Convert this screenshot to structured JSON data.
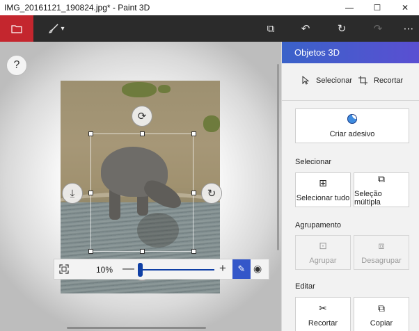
{
  "window": {
    "title": "IMG_20161121_190824.jpg* - Paint 3D",
    "minimize": "—",
    "maximize": "☐",
    "close": "✕"
  },
  "toolbar": {
    "icons": [
      "folder-icon",
      "brush-icon",
      "paste-icon",
      "undo-icon",
      "history-icon",
      "redo-icon",
      "more-icon"
    ],
    "brush_dropdown": "▾",
    "paste": "⧉",
    "undo": "↶",
    "history": "↻",
    "redo": "↷",
    "more": "⋯"
  },
  "canvas": {
    "help": "?",
    "rotate_top": "⟳",
    "rotate_left": "⤓",
    "rotate_right": "↻",
    "rotate_bottom": "⟲"
  },
  "zoom": {
    "percent": "10%",
    "minus": "—",
    "plus": "+",
    "slider_fraction": 0.0,
    "pen": "✎",
    "eye": "◉"
  },
  "panel": {
    "title": "Objetos 3D",
    "select_label": "Selecionar",
    "crop_label": "Recortar",
    "sticker_label": "Criar adesivo",
    "section_select": "Selecionar",
    "select_all_label": "Selecionar tudo",
    "multi_select_label": "Seleção múltipla",
    "section_group": "Agrupamento",
    "group_label": "Agrupar",
    "ungroup_label": "Desagrupar",
    "section_edit": "Editar",
    "cut_label": "Recortar",
    "copy_label": "Copiar"
  },
  "colors": {
    "accent_red": "#c4262e",
    "toolbar_bg": "#2b2b2b",
    "panel_header_start": "#3a62c9",
    "panel_header_end": "#5a4fd2",
    "slider": "#0f3fa5"
  }
}
